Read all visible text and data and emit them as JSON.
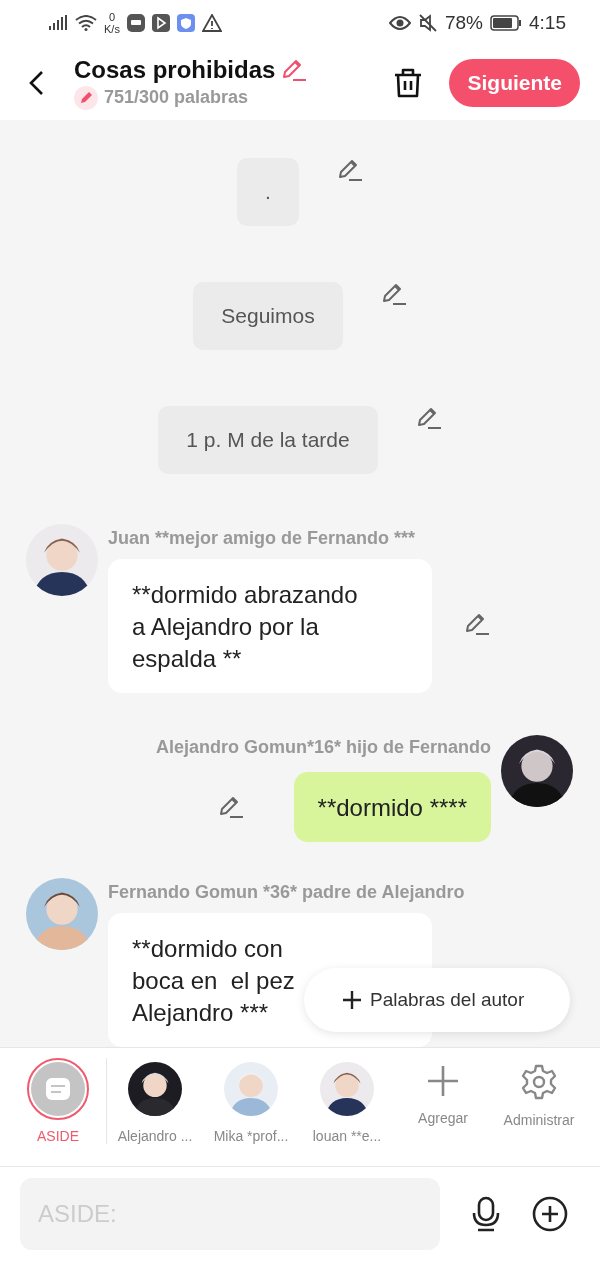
{
  "status_bar": {
    "speed_value": "0",
    "speed_unit": "K/s",
    "battery": "78%",
    "time": "4:15"
  },
  "header": {
    "title": "Cosas prohibidas",
    "word_count": "751/300 palabras",
    "next_button": "Siguiente"
  },
  "messages": [
    {
      "kind": "narration",
      "lines": [
        "."
      ]
    },
    {
      "kind": "narration",
      "lines": [
        "Seguimos"
      ]
    },
    {
      "kind": "narration",
      "lines": [
        "1 p. M de la tarde"
      ]
    },
    {
      "kind": "left",
      "name": "Juan **mejor amigo de Fernando ***",
      "lines": [
        "**dormido abrazando",
        "a Alejandro por la",
        "espalda **"
      ]
    },
    {
      "kind": "right",
      "name": "Alejandro Gomun*16* hijo de Fernando",
      "lines": [
        "**dormido ****"
      ]
    },
    {
      "kind": "left",
      "name": "Fernando Gomun  *36* padre de Alejandro",
      "lines": [
        "**dormido con",
        "boca en  el pez",
        "Alejandro ***"
      ]
    }
  ],
  "floating_button": "Palabras del autor",
  "characters": [
    {
      "kind": "aside",
      "label": "ASIDE",
      "selected": true
    },
    {
      "kind": "avatar",
      "label": "Alejandro ...",
      "selected": false
    },
    {
      "kind": "avatar",
      "label": "Mika *prof...",
      "selected": false
    },
    {
      "kind": "avatar",
      "label": "louan **e...",
      "selected": false
    },
    {
      "kind": "add",
      "label": "Agregar",
      "selected": false
    },
    {
      "kind": "manage",
      "label": "Administrar",
      "selected": false
    }
  ],
  "input": {
    "placeholder": "ASIDE:"
  }
}
